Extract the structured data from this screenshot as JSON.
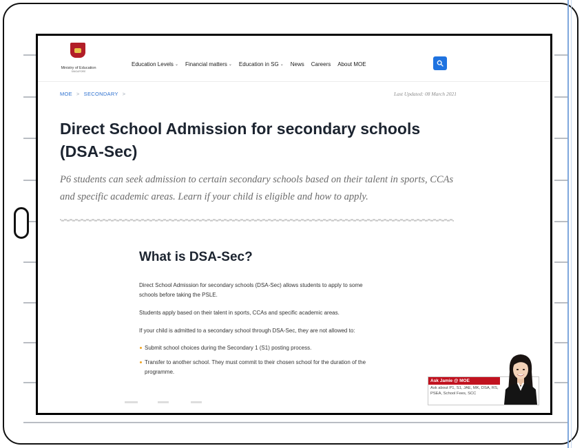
{
  "header": {
    "logo_text": "Ministry of Education",
    "logo_subtext": "SINGAPORE",
    "nav": [
      {
        "label": "Education Levels",
        "has_dropdown": true
      },
      {
        "label": "Financial matters",
        "has_dropdown": true
      },
      {
        "label": "Education in SG",
        "has_dropdown": true
      },
      {
        "label": "News",
        "has_dropdown": false
      },
      {
        "label": "Careers",
        "has_dropdown": false
      },
      {
        "label": "About MOE",
        "has_dropdown": false
      }
    ],
    "search_icon": "search-icon",
    "accent_color": "#1f73e0"
  },
  "breadcrumb": {
    "items": [
      "MOE",
      "SECONDARY"
    ],
    "separator": ">"
  },
  "last_updated": "Last Updated: 08 March 2021",
  "page": {
    "title": "Direct School Admission for secondary schools (DSA-Sec)",
    "lead": "P6 students can seek admission to certain secondary schools based on their talent in sports, CCAs and specific academic areas. Learn if your child is eligible and how to apply."
  },
  "section": {
    "title": "What is DSA-Sec?",
    "paragraphs": [
      "Direct School Admission for secondary schools (DSA-Sec) allows students to apply to some schools before taking the PSLE.",
      "Students apply based on their talent in sports, CCAs and specific academic areas.",
      "If your child is admitted to a secondary school through DSA-Sec, they are not allowed to:"
    ],
    "bullets": [
      "Submit school choices during the Secondary 1 (S1) posting process.",
      "Transfer to another school. They must commit to their chosen school for the duration of the programme."
    ],
    "bullet_color": "#f0a321"
  },
  "ask_jamie": {
    "title": "Ask Jamie @ MOE",
    "text": "Ask about P1, S1, JAE, MK, DSA, RS, PSEA, School Fees, SCC",
    "header_color": "#c1121f"
  }
}
